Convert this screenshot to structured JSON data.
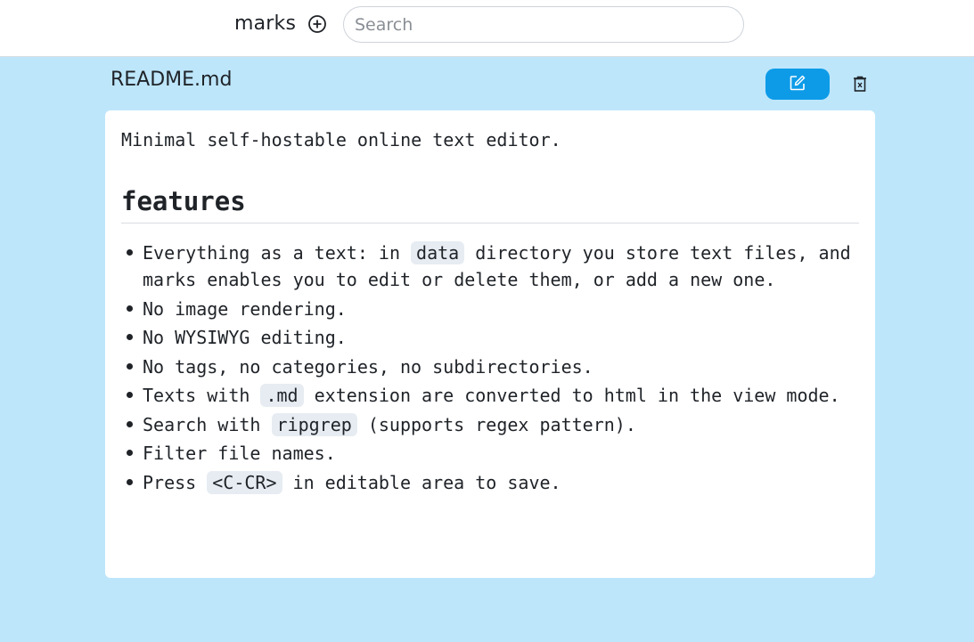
{
  "header": {
    "brand": "marks",
    "add_icon": "plus-circle-icon",
    "search_placeholder": "Search",
    "search_value": ""
  },
  "document": {
    "filename": "README.md",
    "edit_icon": "edit-icon",
    "delete_icon": "trash-icon",
    "intro": "Minimal self-hostable online text editor.",
    "heading": "features",
    "items": [
      {
        "segments": [
          {
            "text": "Everything as a text: in "
          },
          {
            "code": "data"
          },
          {
            "text": " directory you store text files, and marks enables you to edit or delete them, or add a new one."
          }
        ]
      },
      {
        "segments": [
          {
            "text": "No image rendering."
          }
        ]
      },
      {
        "segments": [
          {
            "text": "No WYSIWYG editing."
          }
        ]
      },
      {
        "segments": [
          {
            "text": "No tags, no categories, no subdirectories."
          }
        ]
      },
      {
        "segments": [
          {
            "text": "Texts with "
          },
          {
            "code": ".md"
          },
          {
            "text": " extension are converted to html in the view mode."
          }
        ]
      },
      {
        "segments": [
          {
            "text": "Search with "
          },
          {
            "code": "ripgrep"
          },
          {
            "text": " (supports regex pattern)."
          }
        ]
      },
      {
        "segments": [
          {
            "text": "Filter file names."
          }
        ]
      },
      {
        "segments": [
          {
            "text": "Press "
          },
          {
            "code": "<C-CR>"
          },
          {
            "text": " in editable area to save."
          }
        ]
      }
    ]
  },
  "colors": {
    "page_background": "#bde6fb",
    "accent": "#0d9be8",
    "code_background": "#e6ecf2"
  }
}
